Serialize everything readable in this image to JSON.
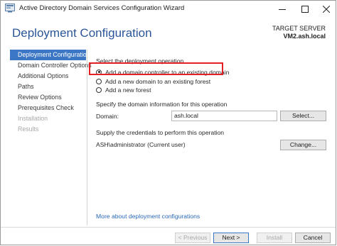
{
  "window": {
    "title": "Active Directory Domain Services Configuration Wizard"
  },
  "header": {
    "title": "Deployment Configuration",
    "target_label": "TARGET SERVER",
    "target_server": "VM2.ash.local"
  },
  "nav": {
    "items": [
      {
        "label": "Deployment Configuration",
        "state": "active"
      },
      {
        "label": "Domain Controller Options",
        "state": "enabled"
      },
      {
        "label": "Additional Options",
        "state": "enabled"
      },
      {
        "label": "Paths",
        "state": "enabled"
      },
      {
        "label": "Review Options",
        "state": "enabled"
      },
      {
        "label": "Prerequisites Check",
        "state": "enabled"
      },
      {
        "label": "Installation",
        "state": "disabled"
      },
      {
        "label": "Results",
        "state": "disabled"
      }
    ]
  },
  "operation": {
    "heading": "Select the deployment operation",
    "options": [
      {
        "label": "Add a domain controller to an existing domain",
        "checked": true
      },
      {
        "label": "Add a new domain to an existing forest",
        "checked": false
      },
      {
        "label": "Add a new forest",
        "checked": false
      }
    ]
  },
  "domain_info": {
    "heading": "Specify the domain information for this operation",
    "domain_label": "Domain:",
    "domain_value": "ash.local",
    "select_button": "Select..."
  },
  "credentials": {
    "heading": "Supply the credentials to perform this operation",
    "current": "ASH\\administrator (Current user)",
    "change_button": "Change..."
  },
  "more_link": "More about deployment configurations",
  "footer": {
    "previous": "< Previous",
    "next": "Next >",
    "install": "Install",
    "cancel": "Cancel"
  },
  "colors": {
    "accent": "#3b77c4",
    "title_blue": "#2a5699",
    "highlight": "#e32121"
  }
}
